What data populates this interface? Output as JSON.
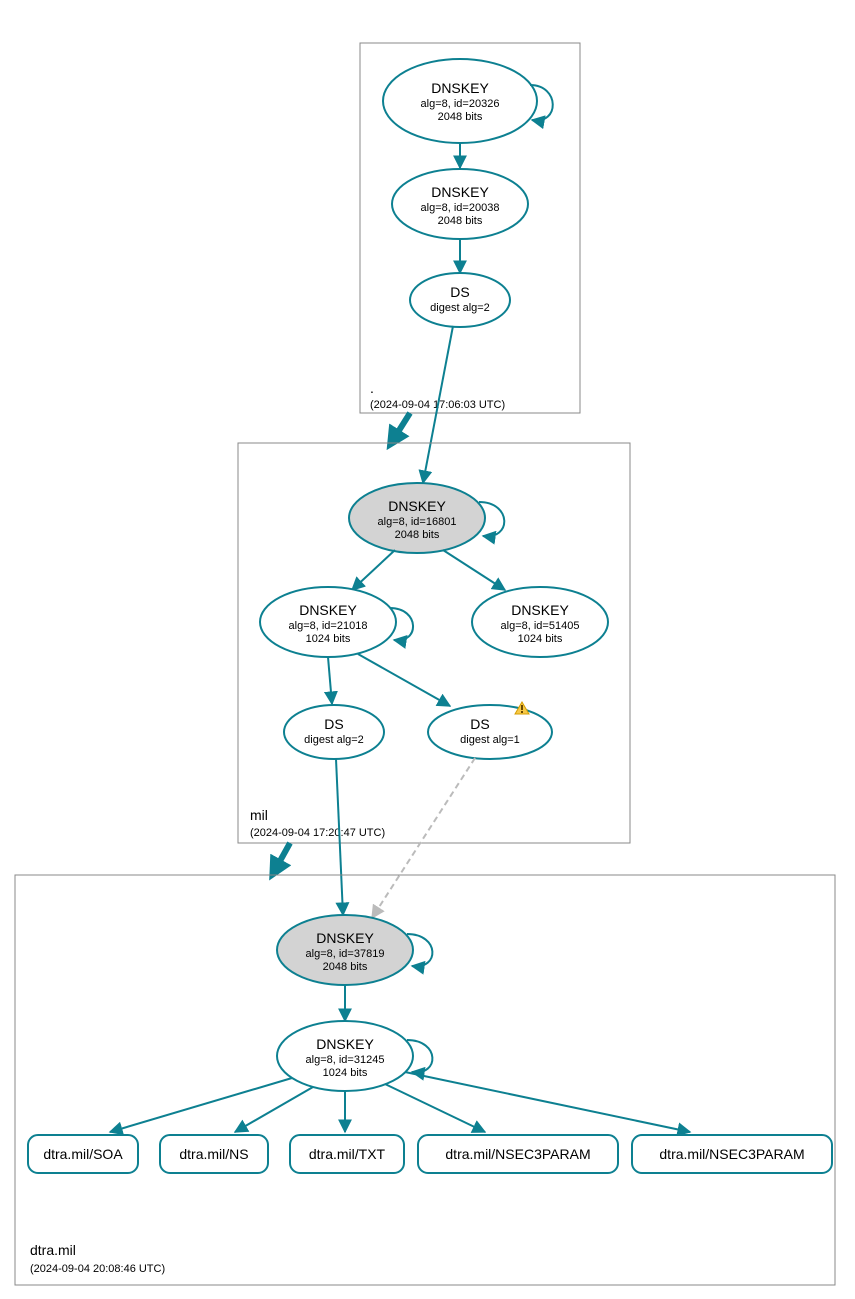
{
  "zones": {
    "root": {
      "label": ".",
      "timestamp": "(2024-09-04 17:06:03 UTC)"
    },
    "mil": {
      "label": "mil",
      "timestamp": "(2024-09-04 17:20:47 UTC)"
    },
    "dtra": {
      "label": "dtra.mil",
      "timestamp": "(2024-09-04 20:08:46 UTC)"
    }
  },
  "nodes": {
    "root_ksk": {
      "title": "DNSKEY",
      "line1": "alg=8, id=20326",
      "line2": "2048 bits"
    },
    "root_zsk": {
      "title": "DNSKEY",
      "line1": "alg=8, id=20038",
      "line2": "2048 bits"
    },
    "root_ds": {
      "title": "DS",
      "line1": "digest alg=2"
    },
    "mil_ksk": {
      "title": "DNSKEY",
      "line1": "alg=8, id=16801",
      "line2": "2048 bits"
    },
    "mil_zsk1": {
      "title": "DNSKEY",
      "line1": "alg=8, id=21018",
      "line2": "1024 bits"
    },
    "mil_zsk2": {
      "title": "DNSKEY",
      "line1": "alg=8, id=51405",
      "line2": "1024 bits"
    },
    "mil_ds1": {
      "title": "DS",
      "line1": "digest alg=2"
    },
    "mil_ds2": {
      "title": "DS",
      "line1": "digest alg=1",
      "warning": true
    },
    "dtra_ksk": {
      "title": "DNSKEY",
      "line1": "alg=8, id=37819",
      "line2": "2048 bits"
    },
    "dtra_zsk": {
      "title": "DNSKEY",
      "line1": "alg=8, id=31245",
      "line2": "1024 bits"
    },
    "rr_soa": {
      "label": "dtra.mil/SOA"
    },
    "rr_ns": {
      "label": "dtra.mil/NS"
    },
    "rr_txt": {
      "label": "dtra.mil/TXT"
    },
    "rr_n3p1": {
      "label": "dtra.mil/NSEC3PARAM"
    },
    "rr_n3p2": {
      "label": "dtra.mil/NSEC3PARAM"
    }
  }
}
